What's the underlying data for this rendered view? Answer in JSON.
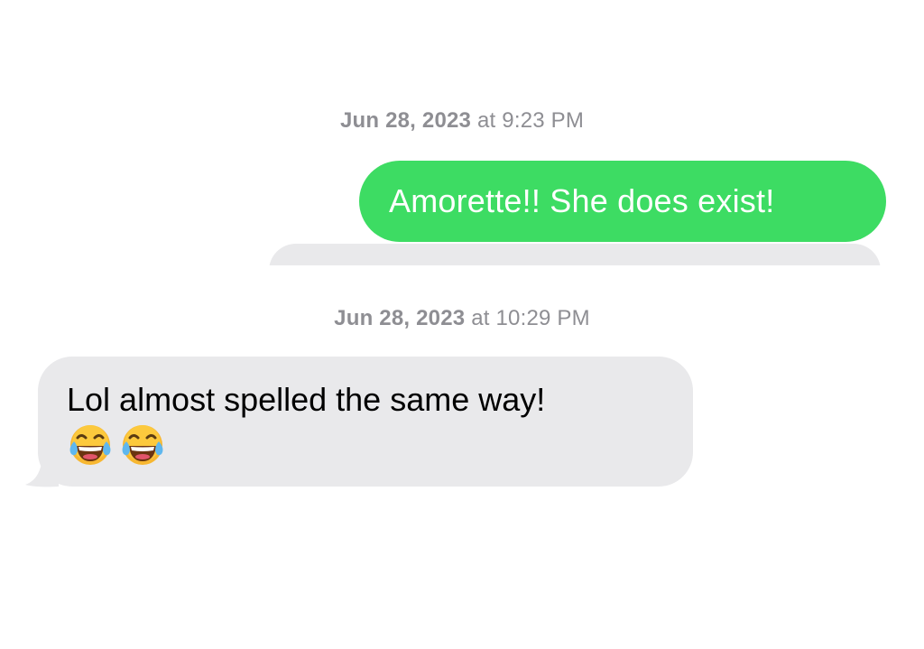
{
  "messages": [
    {
      "timestamp": {
        "date": "Jun 28, 2023",
        "connector": "at",
        "time": "9:23 PM"
      },
      "direction": "outgoing",
      "text": "Amorette!! She does exist!",
      "bubble_color": "#3ddc63"
    },
    {
      "timestamp": {
        "date": "Jun 28, 2023",
        "connector": "at",
        "time": "10:29 PM"
      },
      "direction": "incoming",
      "text": "Lol almost spelled the same way!",
      "emoji": [
        "face-with-tears-of-joy-icon",
        "face-with-tears-of-joy-icon"
      ],
      "bubble_color": "#e9e9eb"
    }
  ],
  "colors": {
    "timestamp": "#8e8e93",
    "outgoing_text": "#ffffff",
    "incoming_text": "#000000",
    "background": "#ffffff"
  }
}
